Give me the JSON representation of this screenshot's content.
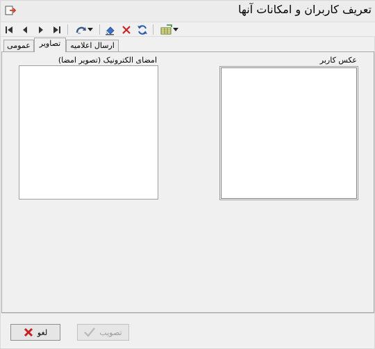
{
  "window": {
    "title": "تعریف کاربران و امکانات آنها"
  },
  "toolbar": {
    "buttons": [
      {
        "id": "first",
        "icon": "first-record-icon"
      },
      {
        "id": "prev",
        "icon": "previous-record-icon"
      },
      {
        "id": "next",
        "icon": "next-record-icon"
      },
      {
        "id": "last",
        "icon": "last-record-icon"
      },
      {
        "id": "actions",
        "icon": "redo-arrow-icon"
      },
      {
        "id": "edit",
        "icon": "eraser-icon"
      },
      {
        "id": "delete",
        "icon": "delete-x-icon"
      },
      {
        "id": "refresh",
        "icon": "refresh-icon"
      },
      {
        "id": "grid",
        "icon": "grid-tools-icon"
      }
    ]
  },
  "tabs": [
    {
      "label": "عمومی",
      "active": false
    },
    {
      "label": "تصاویر",
      "active": true
    },
    {
      "label": "ارسال اعلامیه",
      "active": false
    }
  ],
  "images": {
    "user_photo_label": "عکس کاربر",
    "signature_label": "امضای الکترونیک (تصویر امضا)"
  },
  "footer": {
    "approve_label": "تصویب",
    "cancel_label": "لغو"
  },
  "colors": {
    "delete_red": "#cc2222",
    "refresh_blue": "#2a5db0",
    "cancel_red": "#c62020"
  }
}
